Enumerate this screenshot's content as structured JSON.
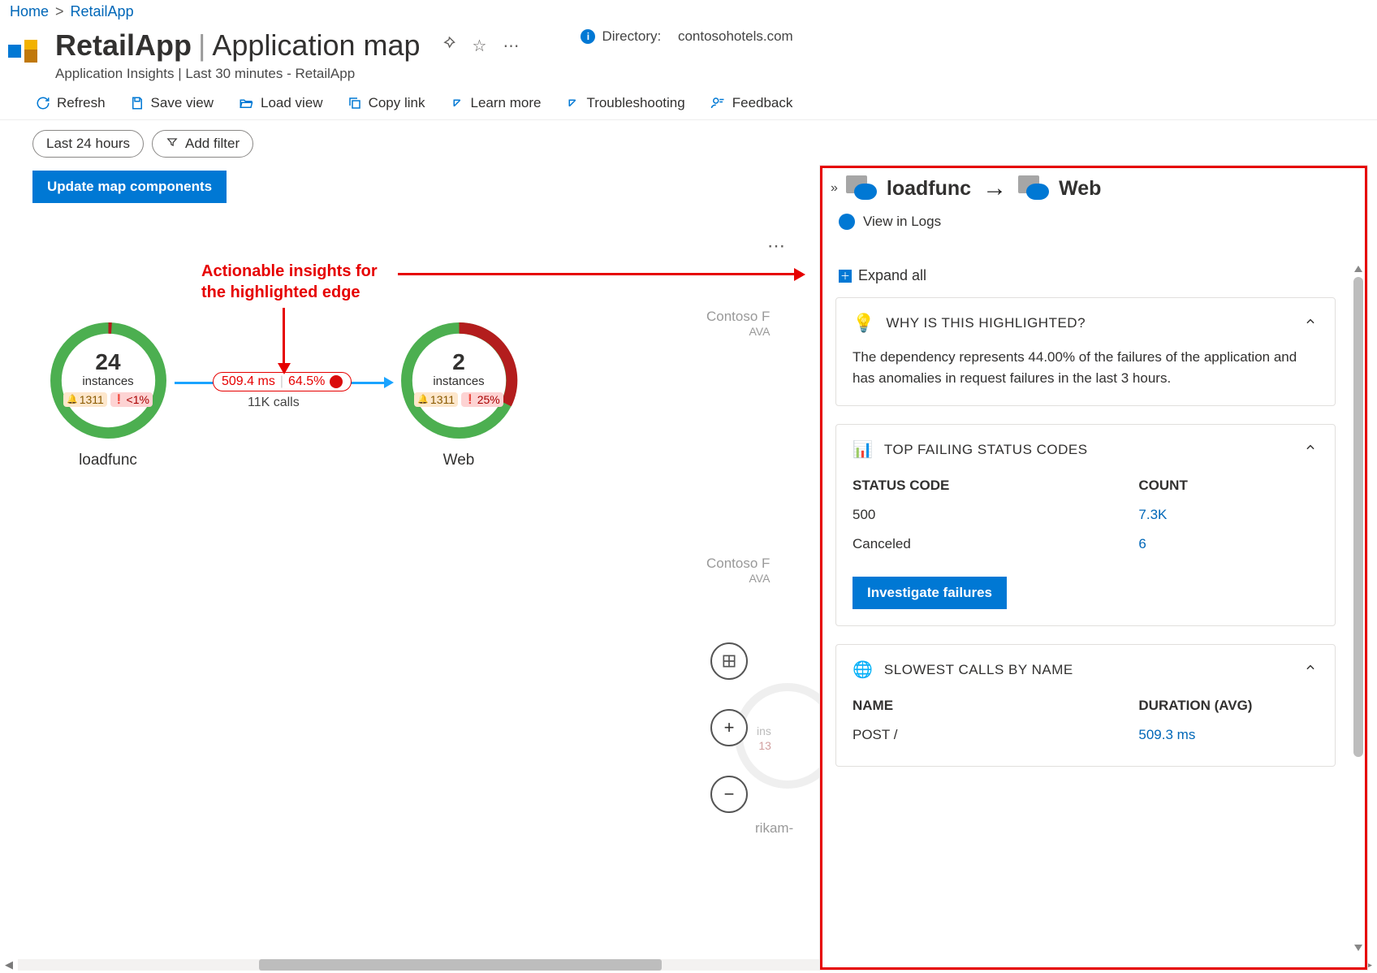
{
  "breadcrumb": {
    "home": "Home",
    "current": "RetailApp"
  },
  "header": {
    "app": "RetailApp",
    "page": "Application map",
    "subtitle": "Application Insights | Last 30 minutes - RetailApp",
    "directory_label": "Directory:",
    "directory": "contosohotels.com"
  },
  "toolbar": {
    "refresh": "Refresh",
    "save_view": "Save view",
    "load_view": "Load view",
    "copy_link": "Copy link",
    "learn_more": "Learn more",
    "troubleshooting": "Troubleshooting",
    "feedback": "Feedback"
  },
  "filters": {
    "time_range": "Last 24 hours",
    "add_filter": "Add filter"
  },
  "update_button": "Update map components",
  "annotation": {
    "line1": "Actionable insights for",
    "line2": "the highlighted edge"
  },
  "nodes": {
    "loadfunc": {
      "name": "loadfunc",
      "count": "24",
      "unit": "instances",
      "alert": "1311",
      "error": "<1%"
    },
    "web": {
      "name": "Web",
      "count": "2",
      "unit": "instances",
      "alert": "1311",
      "error": "25%"
    }
  },
  "edge": {
    "latency": "509.4 ms",
    "percent": "64.5%",
    "calls": "11K calls"
  },
  "ghosts": {
    "top": {
      "name": "Contoso F",
      "sub": "AVA"
    },
    "mid": {
      "name": "Contoso F",
      "sub": "AVA"
    },
    "bottom": "rikam-",
    "instances": "ins",
    "num": "13"
  },
  "panel": {
    "from": "loadfunc",
    "to": "Web",
    "view_in_logs": "View in Logs",
    "expand_all": "Expand all",
    "sections": {
      "why": {
        "title": "WHY IS THIS HIGHLIGHTED?",
        "body": "The dependency represents 44.00% of the failures of the application and has anomalies in request failures in the last 3 hours."
      },
      "status": {
        "title": "TOP FAILING STATUS CODES",
        "col1": "STATUS CODE",
        "col2": "COUNT",
        "rows": [
          {
            "code": "500",
            "count": "7.3K"
          },
          {
            "code": "Canceled",
            "count": "6"
          }
        ],
        "cta": "Investigate failures"
      },
      "slow": {
        "title": "SLOWEST CALLS BY NAME",
        "col1": "NAME",
        "col2": "DURATION (AVG)",
        "rows": [
          {
            "name": "POST /",
            "dur": "509.3 ms"
          }
        ]
      }
    }
  }
}
